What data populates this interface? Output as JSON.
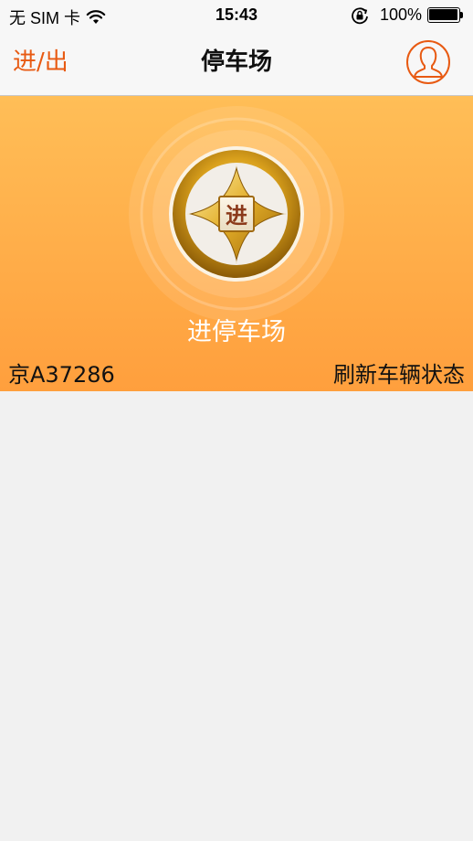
{
  "status_bar": {
    "carrier": "无 SIM 卡",
    "time": "15:43",
    "battery": "100%",
    "icons": [
      "wifi-icon",
      "orientation-lock-icon",
      "battery-icon"
    ]
  },
  "nav": {
    "left_label": "进/出",
    "title": "停车场",
    "right_icon": "user-profile-icon"
  },
  "hero": {
    "coin_character": "进",
    "label": "进停车场",
    "plate": "京A37286",
    "refresh_label": "刷新车辆状态"
  },
  "colors": {
    "accent": "#e85a12",
    "hero_top": "#ffbe57",
    "hero_bottom": "#ff9f3d",
    "background": "#f1f1f1"
  }
}
